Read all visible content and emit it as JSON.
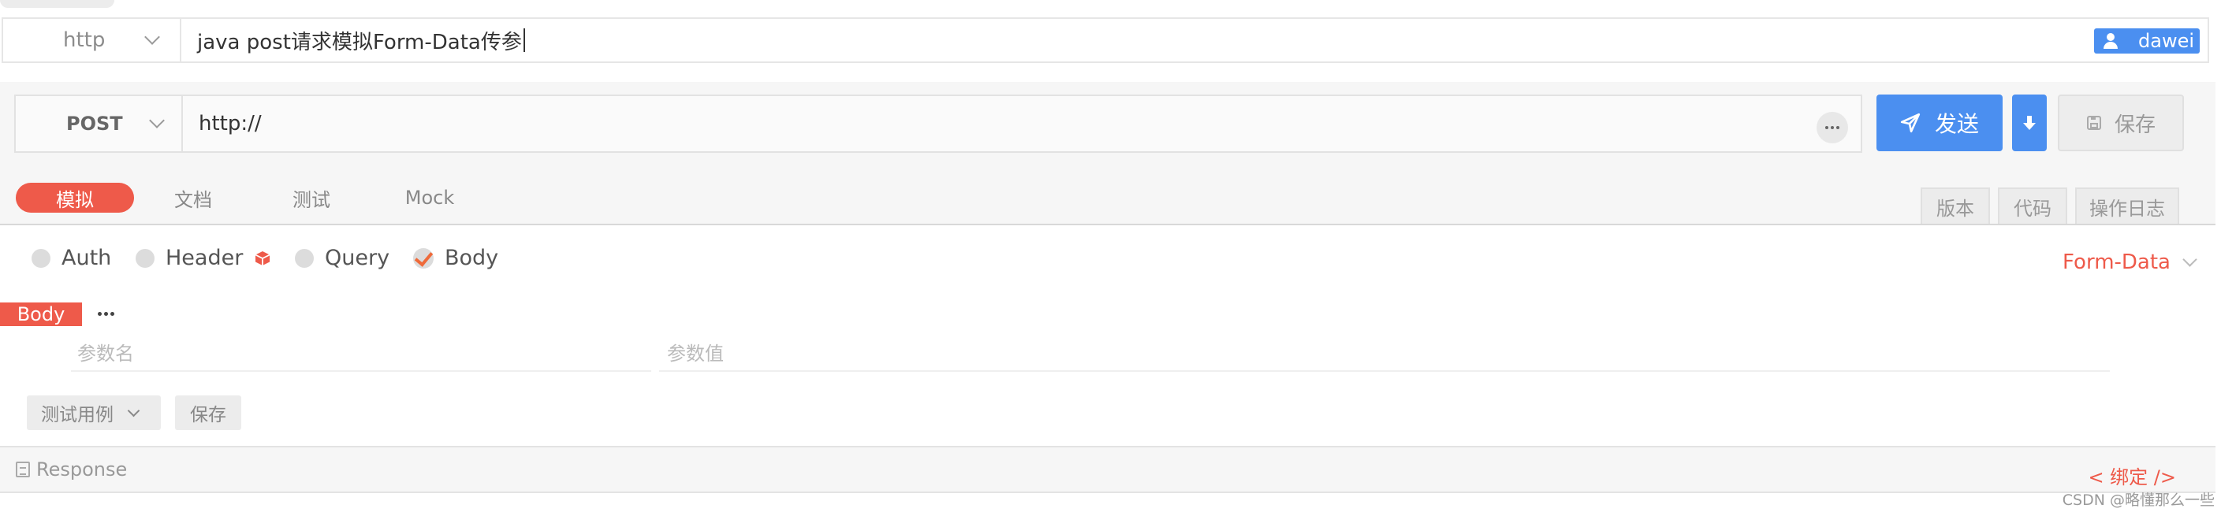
{
  "header": {
    "protocol": "http",
    "title": "java post请求模拟Form-Data传参",
    "user": "dawei"
  },
  "request": {
    "method": "POST",
    "url": "http://",
    "send_label": "发送",
    "save_label": "保存"
  },
  "tabs": [
    {
      "label": "模拟",
      "active": true
    },
    {
      "label": "文档",
      "active": false
    },
    {
      "label": "测试",
      "active": false
    },
    {
      "label": "Mock",
      "active": false
    }
  ],
  "side_tabs": [
    "版本",
    "代码",
    "操作日志"
  ],
  "options": [
    "Auth",
    "Header",
    "Query",
    "Body"
  ],
  "body_type": "Form-Data",
  "body": {
    "tag": "Body",
    "param_name_placeholder": "参数名",
    "param_value_placeholder": "参数值"
  },
  "actions": {
    "testcase_label": "测试用例",
    "save_label": "保存"
  },
  "response": {
    "label": "Response",
    "bind_label": "< 绑定 />"
  },
  "watermark": "CSDN @略懂那么一些",
  "colors": {
    "accent_red": "#ee5a4a",
    "accent_blue": "#4b8ff0"
  }
}
